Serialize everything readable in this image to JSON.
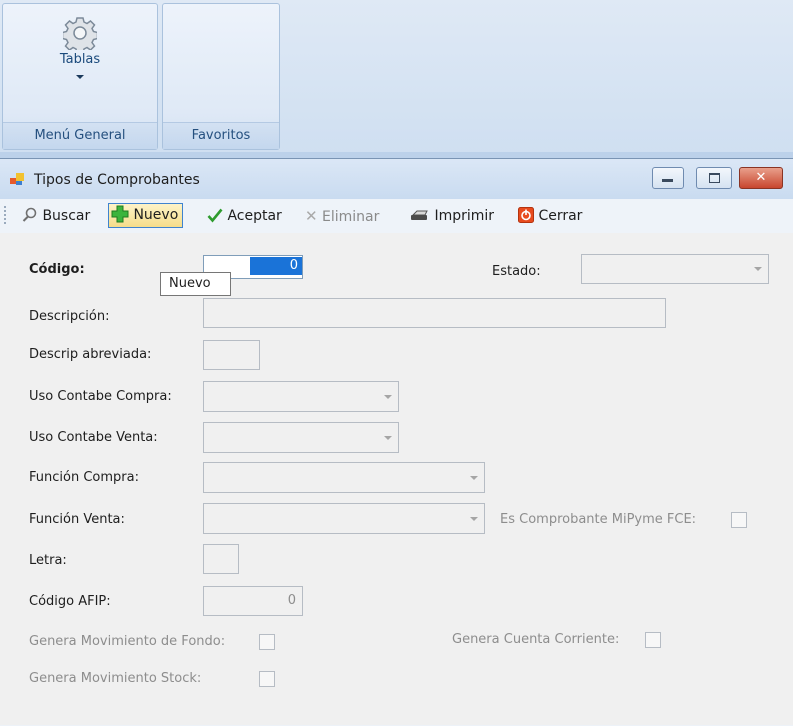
{
  "ribbon": {
    "tables_label": "Tablas",
    "group1_label": "Menú General",
    "group2_label": "Favoritos"
  },
  "window": {
    "title": "Tipos de Comprobantes"
  },
  "toolbar": {
    "search": "Buscar",
    "new": "Nuevo",
    "accept": "Aceptar",
    "delete": "Eliminar",
    "print": "Imprimir",
    "close": "Cerrar"
  },
  "tooltip": "Nuevo",
  "form": {
    "codigo_label": "Código:",
    "codigo_value": "0",
    "estado_label": "Estado:",
    "descripcion_label": "Descripción:",
    "descrip_abrev_label": "Descrip abreviada:",
    "uso_compra_label": "Uso Contabe Compra:",
    "uso_venta_label": "Uso Contabe Venta:",
    "funcion_compra_label": "Función Compra:",
    "funcion_venta_label": "Función Venta:",
    "mipyme_label": "Es Comprobante MiPyme FCE:",
    "letra_label": "Letra:",
    "codigo_afip_label": "Código AFIP:",
    "codigo_afip_value": "0",
    "genera_fondo_label": "Genera Movimiento de Fondo:",
    "genera_cc_label": "Genera Cuenta Corriente:",
    "genera_stock_label": "Genera Movimiento Stock:"
  },
  "colors": {
    "accent_selection": "#1a73d8",
    "close_button": "#c8462e"
  }
}
